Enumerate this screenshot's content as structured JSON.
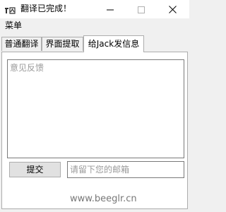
{
  "window": {
    "title": "翻译已完成！",
    "icon": "translator-app-icon",
    "minimize_icon": "minimize-icon",
    "maximize_icon": "maximize-icon",
    "close_icon": "close-icon"
  },
  "menu": {
    "items": [
      "菜单"
    ]
  },
  "tabs": [
    {
      "label": "普通翻译",
      "active": false
    },
    {
      "label": "界面提取",
      "active": false
    },
    {
      "label": "给Jack发信息",
      "active": true
    }
  ],
  "feedback": {
    "placeholder": "意见反馈",
    "value": ""
  },
  "submit": {
    "label": "提交"
  },
  "email": {
    "placeholder": "请留下您的邮箱",
    "value": ""
  },
  "watermark": {
    "text": "www.beeglr.cn"
  },
  "colors": {
    "window_bg": "#f0f0f0",
    "titlebar_bg": "#ffffff",
    "border": "#adadad",
    "placeholder": "#9a9a9a"
  }
}
